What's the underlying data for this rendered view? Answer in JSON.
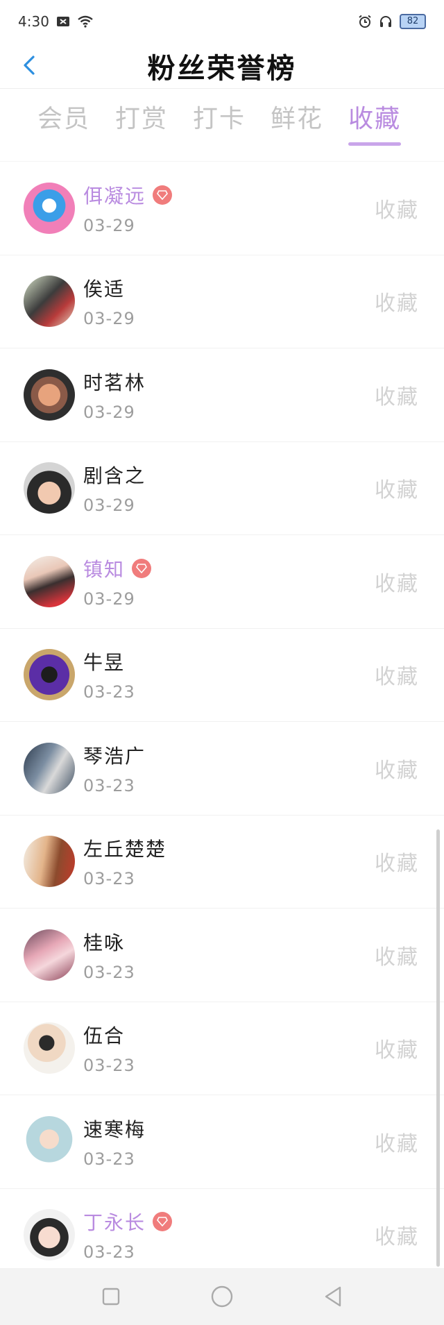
{
  "status_bar": {
    "time": "4:30",
    "battery": "82"
  },
  "header": {
    "title": "粉丝荣誉榜"
  },
  "tabs": [
    {
      "label": "会员",
      "active": false
    },
    {
      "label": "打赏",
      "active": false
    },
    {
      "label": "打卡",
      "active": false
    },
    {
      "label": "鲜花",
      "active": false
    },
    {
      "label": "收藏",
      "active": true
    }
  ],
  "list": {
    "items": [
      {
        "name": "佴凝远",
        "date": "03-29",
        "action": "收藏",
        "vip": true
      },
      {
        "name": "俟适",
        "date": "03-29",
        "action": "收藏",
        "vip": false
      },
      {
        "name": "时茗林",
        "date": "03-29",
        "action": "收藏",
        "vip": false
      },
      {
        "name": "剧含之",
        "date": "03-29",
        "action": "收藏",
        "vip": false
      },
      {
        "name": "镇知",
        "date": "03-29",
        "action": "收藏",
        "vip": true
      },
      {
        "name": "牛昱",
        "date": "03-23",
        "action": "收藏",
        "vip": false
      },
      {
        "name": "琴浩广",
        "date": "03-23",
        "action": "收藏",
        "vip": false
      },
      {
        "name": "左丘楚楚",
        "date": "03-23",
        "action": "收藏",
        "vip": false
      },
      {
        "name": "桂咏",
        "date": "03-23",
        "action": "收藏",
        "vip": false
      },
      {
        "name": "伍合",
        "date": "03-23",
        "action": "收藏",
        "vip": false
      },
      {
        "name": "速寒梅",
        "date": "03-23",
        "action": "收藏",
        "vip": false
      },
      {
        "name": "丁永长",
        "date": "03-23",
        "action": "收藏",
        "vip": true
      }
    ]
  },
  "colors": {
    "accent": "#b98be0",
    "back_arrow": "#2d8fe0",
    "vip_badge": "#f07c7c"
  }
}
